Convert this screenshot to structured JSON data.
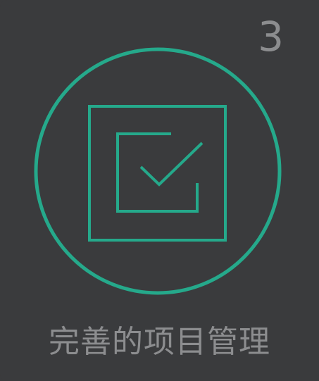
{
  "step": {
    "number": "3"
  },
  "feature": {
    "title": "完善的项目管理",
    "icon": "task-checkbox-icon"
  },
  "colors": {
    "background": "#3a3b3d",
    "accent": "#25a98b",
    "muted_text": "#8c8d8f"
  }
}
